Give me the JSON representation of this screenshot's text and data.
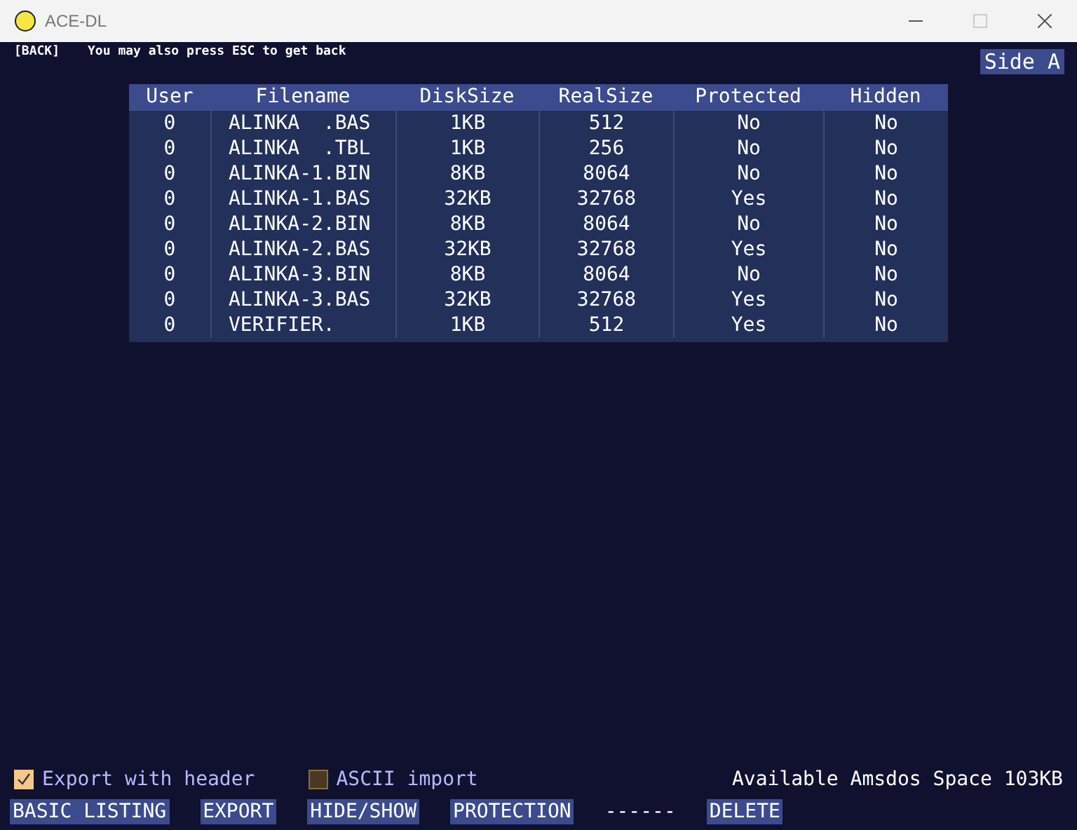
{
  "window": {
    "title": "ACE-DL"
  },
  "back": {
    "label": "[BACK]",
    "hint": "You may also press ESC to get back"
  },
  "side": "Side A",
  "table": {
    "columns": [
      "User",
      "Filename",
      "DiskSize",
      "RealSize",
      "Protected",
      "Hidden"
    ],
    "rows": [
      [
        "0",
        "ALINKA  .BAS",
        "1KB",
        "512",
        "No",
        "No"
      ],
      [
        "0",
        "ALINKA  .TBL",
        "1KB",
        "256",
        "No",
        "No"
      ],
      [
        "0",
        "ALINKA-1.BIN",
        "8KB",
        "8064",
        "No",
        "No"
      ],
      [
        "0",
        "ALINKA-1.BAS",
        "32KB",
        "32768",
        "Yes",
        "No"
      ],
      [
        "0",
        "ALINKA-2.BIN",
        "8KB",
        "8064",
        "No",
        "No"
      ],
      [
        "0",
        "ALINKA-2.BAS",
        "32KB",
        "32768",
        "Yes",
        "No"
      ],
      [
        "0",
        "ALINKA-3.BIN",
        "8KB",
        "8064",
        "No",
        "No"
      ],
      [
        "0",
        "ALINKA-3.BAS",
        "32KB",
        "32768",
        "Yes",
        "No"
      ],
      [
        "0",
        "VERIFIER.",
        "1KB",
        "512",
        "Yes",
        "No"
      ]
    ]
  },
  "options": [
    {
      "label": "Export with header",
      "checked": true
    },
    {
      "label": "ASCII import",
      "checked": false
    }
  ],
  "space": "Available Amsdos Space 103KB",
  "actions": [
    {
      "label": "BASIC LISTING",
      "kind": "button"
    },
    {
      "label": "EXPORT",
      "kind": "button"
    },
    {
      "label": "HIDE/SHOW",
      "kind": "button"
    },
    {
      "label": "PROTECTION",
      "kind": "button"
    },
    {
      "label": "------",
      "kind": "text"
    },
    {
      "label": "DELETE",
      "kind": "button"
    }
  ]
}
